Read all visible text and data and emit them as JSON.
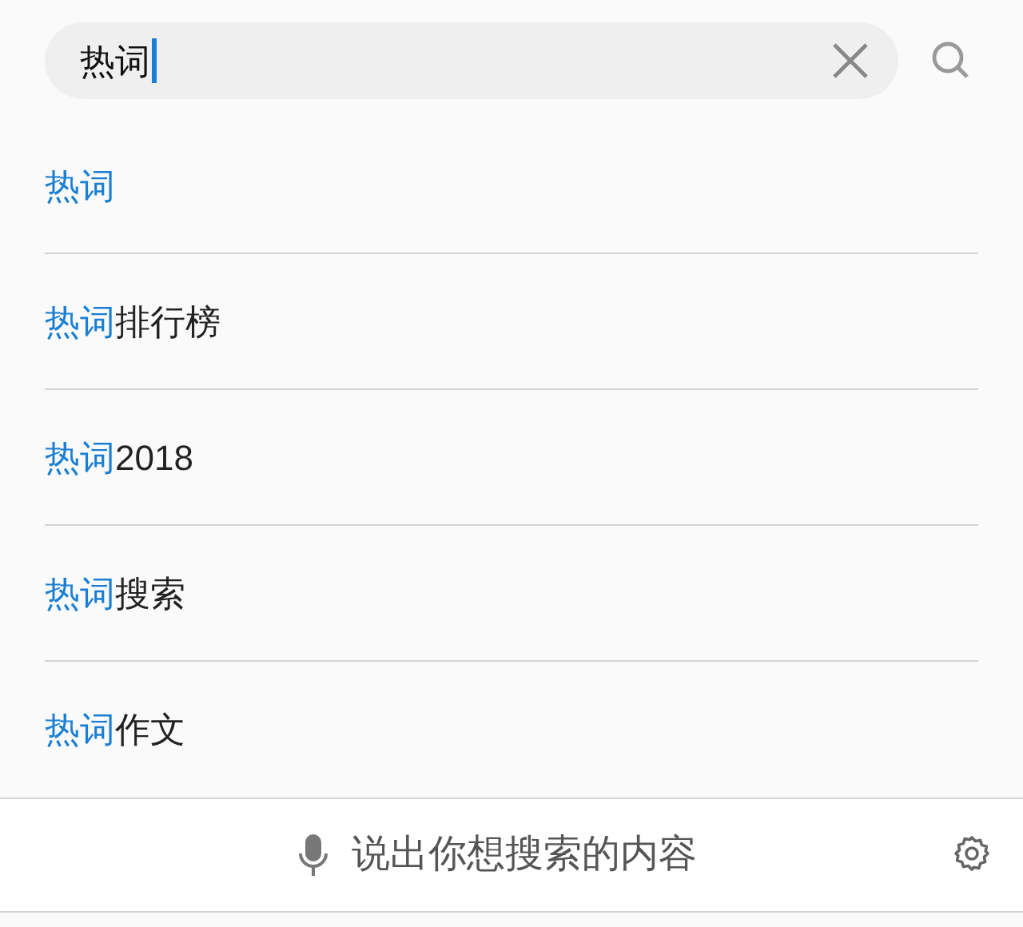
{
  "search": {
    "value": "热词"
  },
  "suggestions": [
    {
      "match": "热词"
    },
    {
      "match": "热词",
      "rest": "排行榜"
    },
    {
      "match": "热词",
      "rest": "2018"
    },
    {
      "match": "热词",
      "rest": "搜索"
    },
    {
      "match": "热词",
      "rest": "作文"
    }
  ],
  "voice_bar": {
    "label": "说出你想搜索的内容"
  }
}
